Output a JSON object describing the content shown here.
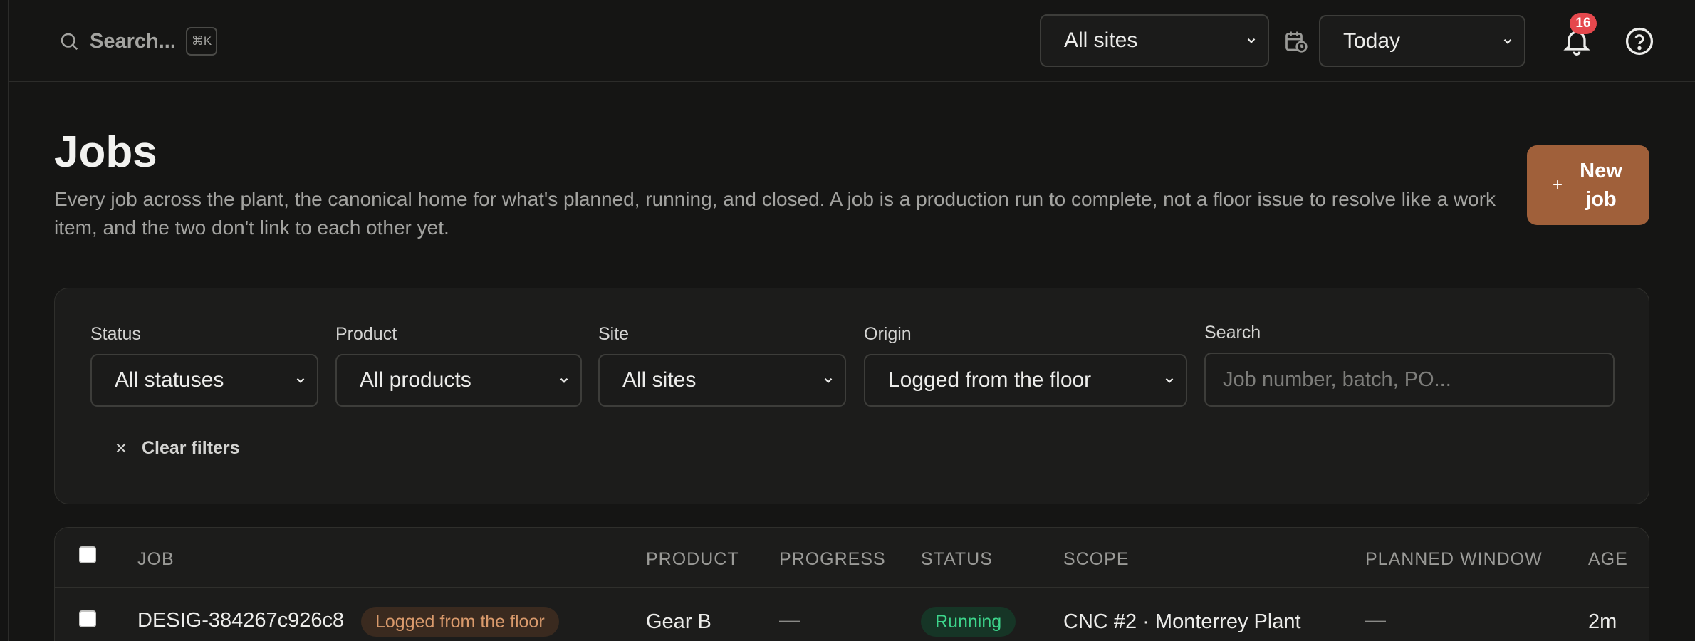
{
  "topbar": {
    "search_label": "Search...",
    "search_shortcut": "⌘K",
    "site_select": "All sites",
    "date_select": "Today",
    "notification_count": "16"
  },
  "page": {
    "title": "Jobs",
    "description": "Every job across the plant, the canonical home for what's planned, running, and closed. A job is a production run to complete, not a floor issue to resolve like a work item, and the two don't link to each other yet.",
    "new_button": "New job"
  },
  "filters": {
    "status": {
      "label": "Status",
      "value": "All statuses"
    },
    "product": {
      "label": "Product",
      "value": "All products"
    },
    "site": {
      "label": "Site",
      "value": "All sites"
    },
    "origin": {
      "label": "Origin",
      "value": "Logged from the floor"
    },
    "search": {
      "label": "Search",
      "placeholder": "Job number, batch, PO..."
    },
    "clear_label": "Clear filters"
  },
  "table": {
    "columns": [
      "JOB",
      "PRODUCT",
      "PROGRESS",
      "STATUS",
      "SCOPE",
      "PLANNED WINDOW",
      "AGE"
    ],
    "rows": [
      {
        "job": "DESIG-384267c926c8",
        "origin": "Logged from the floor",
        "product": "Gear B",
        "progress": "—",
        "status": "Running",
        "scope": "CNC #2 · Monterrey Plant",
        "planned_window": "—",
        "age": "2m"
      }
    ]
  },
  "colors": {
    "background": "#151514",
    "accent": "#a0603a",
    "badge": "#e5484d",
    "running": "#3dd68c"
  }
}
